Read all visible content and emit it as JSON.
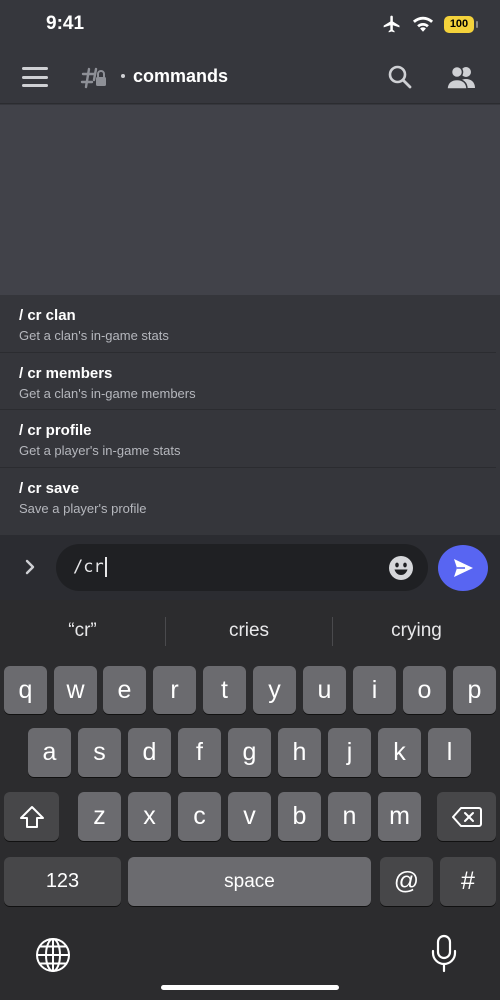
{
  "status_bar": {
    "time": "9:41",
    "battery": "100"
  },
  "header": {
    "channel_name": "commands",
    "icons": [
      "hamburger-menu-icon",
      "locked-channel-icon",
      "search-icon",
      "members-icon"
    ]
  },
  "commands": [
    {
      "name": "/ cr clan",
      "description": "Get a clan's in-game stats"
    },
    {
      "name": "/ cr members",
      "description": "Get a clan's in-game members"
    },
    {
      "name": "/ cr profile",
      "description": "Get a player's in-game stats"
    },
    {
      "name": "/ cr save",
      "description": "Save a player's profile"
    }
  ],
  "input": {
    "value": "/cr",
    "icons": [
      "chevron-right-icon",
      "emoji-icon",
      "send-icon"
    ]
  },
  "keyboard": {
    "suggestions": [
      "“cr”",
      "cries",
      "crying"
    ],
    "row1": [
      "q",
      "w",
      "e",
      "r",
      "t",
      "y",
      "u",
      "i",
      "o",
      "p"
    ],
    "row2": [
      "a",
      "s",
      "d",
      "f",
      "g",
      "h",
      "j",
      "k",
      "l"
    ],
    "row3": [
      "z",
      "x",
      "c",
      "v",
      "b",
      "n",
      "m"
    ],
    "numbers_key": "123",
    "space_key": "space",
    "at_key": "@",
    "hash_key": "#"
  },
  "colors": {
    "accent": "#5865f2",
    "battery": "#f4d23b",
    "background": "#36373d"
  }
}
